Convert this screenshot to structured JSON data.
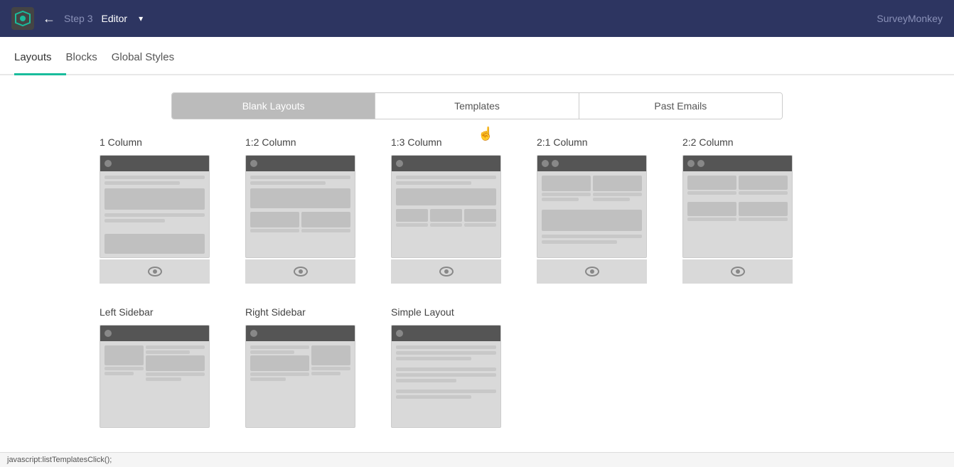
{
  "topBar": {
    "backArrow": "←",
    "stepLabel": "Step 3",
    "editorLabel": "Editor",
    "dropdownIcon": "▾",
    "brandName": "SurveyMonkey"
  },
  "subNav": {
    "items": [
      {
        "id": "layouts",
        "label": "Layouts",
        "active": true
      },
      {
        "id": "blocks",
        "label": "Blocks",
        "active": false
      },
      {
        "id": "global-styles",
        "label": "Global Styles",
        "active": false
      }
    ]
  },
  "layoutSelector": {
    "buttons": [
      {
        "id": "blank-layouts",
        "label": "Blank Layouts",
        "active": true
      },
      {
        "id": "templates",
        "label": "Templates",
        "active": false
      },
      {
        "id": "past-emails",
        "label": "Past Emails",
        "active": false
      }
    ]
  },
  "layouts": [
    {
      "id": "1col",
      "title": "1 Column",
      "type": "single"
    },
    {
      "id": "1_2col",
      "title": "1:2 Column",
      "type": "one-two"
    },
    {
      "id": "1_3col",
      "title": "1:3 Column",
      "type": "one-three"
    },
    {
      "id": "2_1col",
      "title": "2:1 Column",
      "type": "two-one"
    },
    {
      "id": "2_2col",
      "title": "2:2 Column",
      "type": "two-two"
    },
    {
      "id": "left-sidebar",
      "title": "Left Sidebar",
      "type": "left-sidebar"
    },
    {
      "id": "right-sidebar",
      "title": "Right Sidebar",
      "type": "right-sidebar"
    },
    {
      "id": "simple-layout",
      "title": "Simple Layout",
      "type": "simple"
    }
  ],
  "statusBar": {
    "text": "javascript:listTemplatesClick();"
  },
  "icons": {
    "eye": "👁"
  }
}
